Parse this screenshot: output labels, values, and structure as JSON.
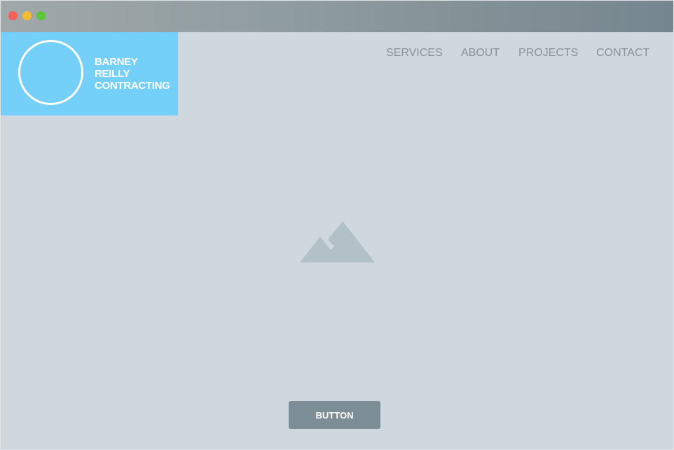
{
  "window": {
    "traffic_lights": [
      "close",
      "minimize",
      "zoom"
    ]
  },
  "logo": {
    "line1": "BARNEY",
    "line2": "REILLY",
    "line3": "CONTRACTING"
  },
  "nav": {
    "items": [
      {
        "label": "SERVICES"
      },
      {
        "label": "ABOUT"
      },
      {
        "label": "PROJECTS"
      },
      {
        "label": "CONTACT"
      }
    ]
  },
  "hero": {
    "image_icon": "mountain-image-placeholder-icon"
  },
  "cta": {
    "label": "BUTTON"
  },
  "colors": {
    "logo_bg": "#74cff9",
    "page_bg": "#cfd8de",
    "button_bg": "#7c8d95",
    "nav_text": "#8a9296"
  }
}
